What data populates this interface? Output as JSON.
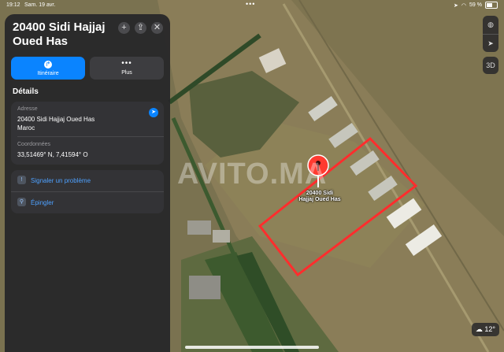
{
  "status": {
    "time": "19:12",
    "date": "Sam. 19 avr.",
    "battery": "59 %",
    "battery_level": 0.59
  },
  "place": {
    "title": "20400 Sidi Hajjaj Oued Has",
    "route_label": "Itinéraire",
    "more_label": "Plus",
    "details_heading": "Détails",
    "address_label": "Adresse",
    "address_line1": "20400 Sidi Hajjaj Oued Has",
    "address_line2": "Maroc",
    "coords_label": "Coordonnées",
    "coords_value": "33,51469° N, 7,41594° O",
    "report_label": "Signaler un problème",
    "pin_label": "Épingler"
  },
  "map": {
    "pin_name": "20400 Sidi Hajjaj Oued Has",
    "pin_line1": "20400 Sidi",
    "pin_line2": "Hajjaj Oued Has",
    "view_3d_label": "3D",
    "temperature": "12°",
    "watermark": "AVITO.MA",
    "boundary_color": "#ff2d2d",
    "pin_color": "#ff3b30"
  }
}
